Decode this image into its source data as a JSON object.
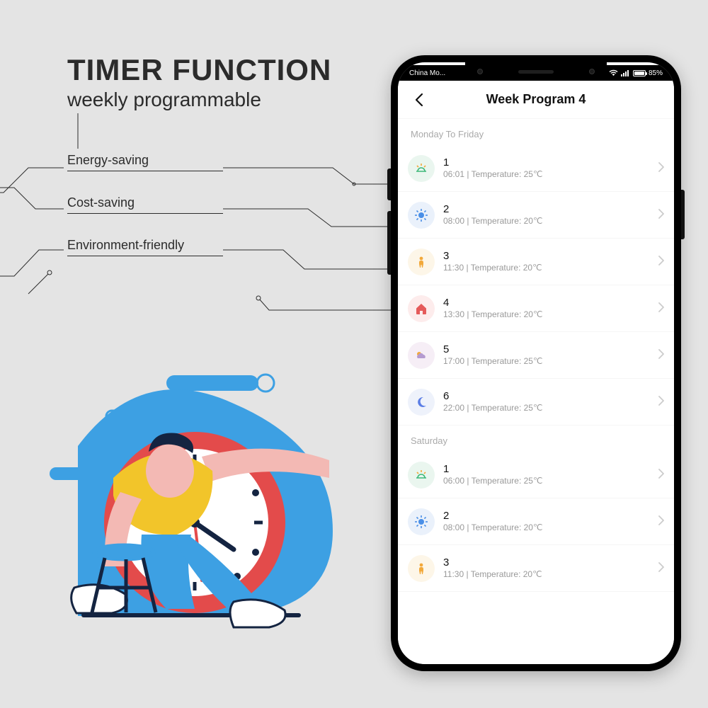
{
  "hero": {
    "title": "TIMER FUNCTION",
    "subtitle": "weekly programmable"
  },
  "features": [
    "Energy-saving",
    "Cost-saving",
    "Environment-friendly"
  ],
  "statusbar": {
    "carrier": "China Mo... ",
    "battery_text": "85%"
  },
  "app": {
    "title": "Week Program 4",
    "sections": [
      {
        "label": "Monday To Friday",
        "entries": [
          {
            "num": "1",
            "time": "06:01",
            "temp": "25℃",
            "icon": "sunrise"
          },
          {
            "num": "2",
            "time": "08:00",
            "temp": "20℃",
            "icon": "sun"
          },
          {
            "num": "3",
            "time": "11:30",
            "temp": "20℃",
            "icon": "person"
          },
          {
            "num": "4",
            "time": "13:30",
            "temp": "20℃",
            "icon": "home"
          },
          {
            "num": "5",
            "time": "17:00",
            "temp": "25℃",
            "icon": "cloud"
          },
          {
            "num": "6",
            "time": "22:00",
            "temp": "25℃",
            "icon": "moon"
          }
        ]
      },
      {
        "label": "Saturday",
        "entries": [
          {
            "num": "1",
            "time": "06:00",
            "temp": "25℃",
            "icon": "sunrise"
          },
          {
            "num": "2",
            "time": "08:00",
            "temp": "20℃",
            "icon": "sun"
          },
          {
            "num": "3",
            "time": "11:30",
            "temp": "20℃",
            "icon": "person"
          }
        ]
      }
    ],
    "detail_prefix_sep": "  |  ",
    "detail_temp_label": "Temperature: "
  }
}
